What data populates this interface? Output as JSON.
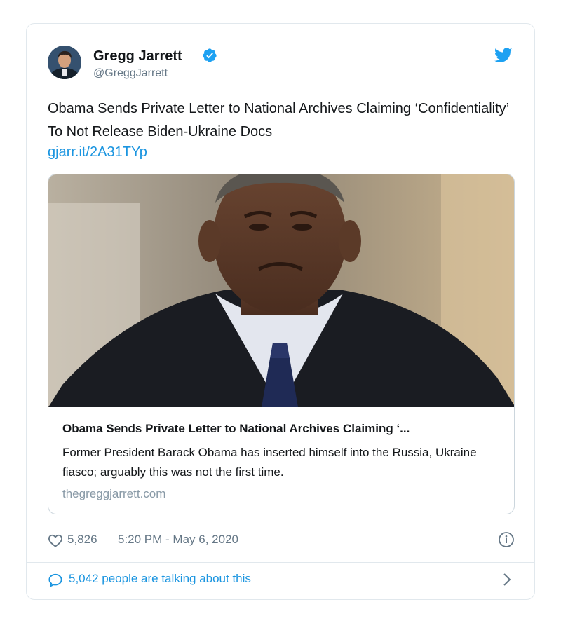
{
  "author": {
    "name": "Gregg Jarrett",
    "handle": "@GreggJarrett"
  },
  "tweet": {
    "text": "Obama Sends Private Letter to National Archives Claiming ‘Confidentiality’ To Not Release Biden-Ukraine Docs",
    "link": "gjarr.it/2A31TYp"
  },
  "card": {
    "title": "Obama Sends Private Letter to National Archives Claiming ‘...",
    "description": "Former President Barack Obama has inserted himself into the Russia, Ukraine fiasco; arguably this was not the first time.",
    "domain": "thegreggjarrett.com"
  },
  "meta": {
    "likes": "5,826",
    "timestamp": "5:20 PM - May 6, 2020"
  },
  "talking": {
    "label": "5,042 people are talking about this"
  },
  "icons": {
    "verified": "verified-badge-icon",
    "brand": "twitter-bird-icon",
    "like": "heart-icon",
    "info": "info-icon",
    "reply": "comment-icon",
    "more": "chevron-right-icon"
  },
  "colors": {
    "accent": "#1b95e0",
    "text": "#14171a",
    "muted": "#657786",
    "border": "#e1e8ed"
  }
}
